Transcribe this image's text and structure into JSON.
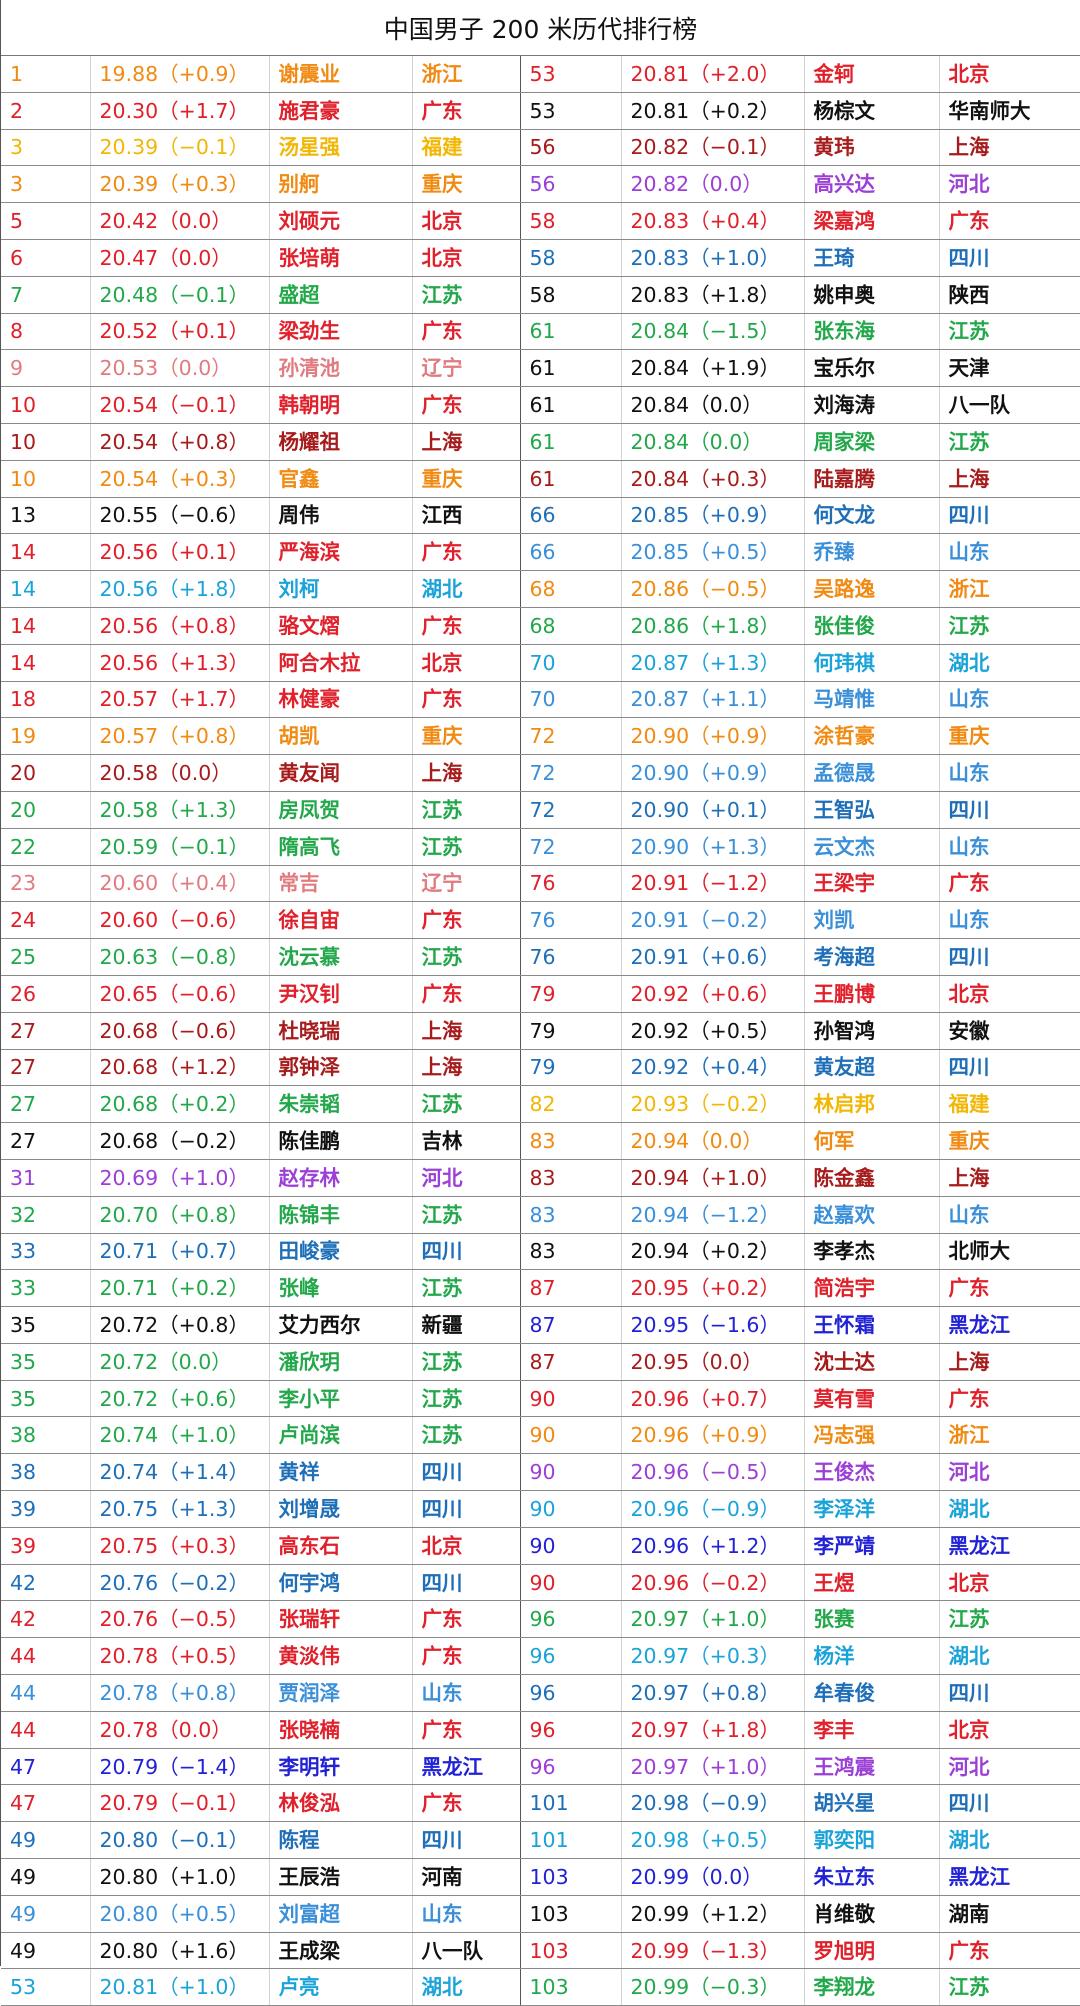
{
  "title": "中国男子 200 米历代排行榜",
  "colors": {
    "blk": "#111111",
    "red": "#e0202a",
    "dred": "#a61b1b",
    "orange": "#f08a12",
    "gold": "#f2b705",
    "green": "#22a84a",
    "pink": "#e07b80",
    "sky": "#1aa3d9",
    "blue": "#1f6fb8",
    "lblue": "#3a8fd8",
    "purple": "#9b3fd6",
    "navy": "#2121d6"
  },
  "rows": [
    {
      "left": {
        "rank": "1",
        "time": "19.88（+0.9）",
        "name": "谢震业",
        "prov": "浙江",
        "color": "orange"
      },
      "right": {
        "rank": "53",
        "time": "20.81（+2.0）",
        "name": "金轲",
        "prov": "北京",
        "color": "red"
      }
    },
    {
      "left": {
        "rank": "2",
        "time": "20.30（+1.7）",
        "name": "施君豪",
        "prov": "广东",
        "color": "red"
      },
      "right": {
        "rank": "53",
        "time": "20.81（+0.2）",
        "name": "杨棕文",
        "prov": "华南师大",
        "color": "blk"
      }
    },
    {
      "left": {
        "rank": "3",
        "time": "20.39（−0.1）",
        "name": "汤星强",
        "prov": "福建",
        "color": "gold"
      },
      "right": {
        "rank": "56",
        "time": "20.82（−0.1）",
        "name": "黄玮",
        "prov": "上海",
        "color": "dred"
      }
    },
    {
      "left": {
        "rank": "3",
        "time": "20.39（+0.3）",
        "name": "别舸",
        "prov": "重庆",
        "color": "orange"
      },
      "right": {
        "rank": "56",
        "time": "20.82（0.0）",
        "name": "高兴达",
        "prov": "河北",
        "color": "purple"
      }
    },
    {
      "left": {
        "rank": "5",
        "time": "20.42（0.0）",
        "name": "刘硕元",
        "prov": "北京",
        "color": "red"
      },
      "right": {
        "rank": "58",
        "time": "20.83（+0.4）",
        "name": "梁嘉鸿",
        "prov": "广东",
        "color": "red"
      }
    },
    {
      "left": {
        "rank": "6",
        "time": "20.47（0.0）",
        "name": "张培萌",
        "prov": "北京",
        "color": "red"
      },
      "right": {
        "rank": "58",
        "time": "20.83（+1.0）",
        "name": "王琦",
        "prov": "四川",
        "color": "blue"
      }
    },
    {
      "left": {
        "rank": "7",
        "time": "20.48（−0.1）",
        "name": "盛超",
        "prov": "江苏",
        "color": "green"
      },
      "right": {
        "rank": "58",
        "time": "20.83（+1.8）",
        "name": "姚申奥",
        "prov": "陕西",
        "color": "blk"
      }
    },
    {
      "left": {
        "rank": "8",
        "time": "20.52（+0.1）",
        "name": "梁劲生",
        "prov": "广东",
        "color": "red"
      },
      "right": {
        "rank": "61",
        "time": "20.84（−1.5）",
        "name": "张东海",
        "prov": "江苏",
        "color": "green"
      }
    },
    {
      "left": {
        "rank": "9",
        "time": "20.53（0.0）",
        "name": "孙清池",
        "prov": "辽宁",
        "color": "pink"
      },
      "right": {
        "rank": "61",
        "time": "20.84（+1.9）",
        "name": "宝乐尔",
        "prov": "天津",
        "color": "blk"
      }
    },
    {
      "left": {
        "rank": "10",
        "time": "20.54（−0.1）",
        "name": "韩朝明",
        "prov": "广东",
        "color": "red"
      },
      "right": {
        "rank": "61",
        "time": "20.84（0.0）",
        "name": "刘海涛",
        "prov": "八一队",
        "color": "blk"
      }
    },
    {
      "left": {
        "rank": "10",
        "time": "20.54（+0.8）",
        "name": "杨耀祖",
        "prov": "上海",
        "color": "dred"
      },
      "right": {
        "rank": "61",
        "time": "20.84（0.0）",
        "name": "周家梁",
        "prov": "江苏",
        "color": "green"
      }
    },
    {
      "left": {
        "rank": "10",
        "time": "20.54（+0.3）",
        "name": "官鑫",
        "prov": "重庆",
        "color": "orange"
      },
      "right": {
        "rank": "61",
        "time": "20.84（+0.3）",
        "name": "陆嘉腾",
        "prov": "上海",
        "color": "dred"
      }
    },
    {
      "left": {
        "rank": "13",
        "time": "20.55（−0.6）",
        "name": "周伟",
        "prov": "江西",
        "color": "blk"
      },
      "right": {
        "rank": "66",
        "time": "20.85（+0.9）",
        "name": "何文龙",
        "prov": "四川",
        "color": "blue"
      }
    },
    {
      "left": {
        "rank": "14",
        "time": "20.56（+0.1）",
        "name": "严海滨",
        "prov": "广东",
        "color": "red"
      },
      "right": {
        "rank": "66",
        "time": "20.85（+0.5）",
        "name": "乔臻",
        "prov": "山东",
        "color": "lblue"
      }
    },
    {
      "left": {
        "rank": "14",
        "time": "20.56（+1.8）",
        "name": "刘柯",
        "prov": "湖北",
        "color": "sky"
      },
      "right": {
        "rank": "68",
        "time": "20.86（−0.5）",
        "name": "吴路逸",
        "prov": "浙江",
        "color": "orange"
      }
    },
    {
      "left": {
        "rank": "14",
        "time": "20.56（+0.8）",
        "name": "骆文熠",
        "prov": "广东",
        "color": "red"
      },
      "right": {
        "rank": "68",
        "time": "20.86（+1.8）",
        "name": "张佳俊",
        "prov": "江苏",
        "color": "green"
      }
    },
    {
      "left": {
        "rank": "14",
        "time": "20.56（+1.3）",
        "name": "阿合木拉",
        "prov": "北京",
        "color": "red"
      },
      "right": {
        "rank": "70",
        "time": "20.87（+1.3）",
        "name": "何玮祺",
        "prov": "湖北",
        "color": "sky"
      }
    },
    {
      "left": {
        "rank": "18",
        "time": "20.57（+1.7）",
        "name": "林健豪",
        "prov": "广东",
        "color": "red"
      },
      "right": {
        "rank": "70",
        "time": "20.87（+1.1）",
        "name": "马靖惟",
        "prov": "山东",
        "color": "lblue"
      }
    },
    {
      "left": {
        "rank": "19",
        "time": "20.57（+0.8）",
        "name": "胡凯",
        "prov": "重庆",
        "color": "orange"
      },
      "right": {
        "rank": "72",
        "time": "20.90（+0.9）",
        "name": "涂哲豪",
        "prov": "重庆",
        "color": "orange"
      }
    },
    {
      "left": {
        "rank": "20",
        "time": "20.58（0.0）",
        "name": "黄友闻",
        "prov": "上海",
        "color": "dred"
      },
      "right": {
        "rank": "72",
        "time": "20.90（+0.9）",
        "name": "孟德晟",
        "prov": "山东",
        "color": "lblue"
      }
    },
    {
      "left": {
        "rank": "20",
        "time": "20.58（+1.3）",
        "name": "房凤贺",
        "prov": "江苏",
        "color": "green"
      },
      "right": {
        "rank": "72",
        "time": "20.90（+0.1）",
        "name": "王智弘",
        "prov": "四川",
        "color": "blue"
      }
    },
    {
      "left": {
        "rank": "22",
        "time": "20.59（−0.1）",
        "name": "隋高飞",
        "prov": "江苏",
        "color": "green"
      },
      "right": {
        "rank": "72",
        "time": "20.90（+1.3）",
        "name": "云文杰",
        "prov": "山东",
        "color": "lblue"
      }
    },
    {
      "left": {
        "rank": "23",
        "time": "20.60（+0.4）",
        "name": "常吉",
        "prov": "辽宁",
        "color": "pink"
      },
      "right": {
        "rank": "76",
        "time": "20.91（−1.2）",
        "name": "王梁宇",
        "prov": "广东",
        "color": "red"
      }
    },
    {
      "left": {
        "rank": "24",
        "time": "20.60（−0.6）",
        "name": "徐自宙",
        "prov": "广东",
        "color": "red"
      },
      "right": {
        "rank": "76",
        "time": "20.91（−0.2）",
        "name": "刘凯",
        "prov": "山东",
        "color": "lblue"
      }
    },
    {
      "left": {
        "rank": "25",
        "time": "20.63（−0.8）",
        "name": "沈云慕",
        "prov": "江苏",
        "color": "green"
      },
      "right": {
        "rank": "76",
        "time": "20.91（+0.6）",
        "name": "考海超",
        "prov": "四川",
        "color": "blue"
      }
    },
    {
      "left": {
        "rank": "26",
        "time": "20.65（−0.6）",
        "name": "尹汉钊",
        "prov": "广东",
        "color": "red"
      },
      "right": {
        "rank": "79",
        "time": "20.92（+0.6）",
        "name": "王鹏博",
        "prov": "北京",
        "color": "red"
      }
    },
    {
      "left": {
        "rank": "27",
        "time": "20.68（−0.6）",
        "name": "杜晓瑞",
        "prov": "上海",
        "color": "dred"
      },
      "right": {
        "rank": "79",
        "time": "20.92（+0.5）",
        "name": "孙智鸿",
        "prov": "安徽",
        "color": "blk"
      }
    },
    {
      "left": {
        "rank": "27",
        "time": "20.68（+1.2）",
        "name": "郭钟泽",
        "prov": "上海",
        "color": "dred"
      },
      "right": {
        "rank": "79",
        "time": "20.92（+0.4）",
        "name": "黄友超",
        "prov": "四川",
        "color": "blue"
      }
    },
    {
      "left": {
        "rank": "27",
        "time": "20.68（+0.2）",
        "name": "朱崇韬",
        "prov": "江苏",
        "color": "green"
      },
      "right": {
        "rank": "82",
        "time": "20.93（−0.2）",
        "name": "林启邦",
        "prov": "福建",
        "color": "gold"
      }
    },
    {
      "left": {
        "rank": "27",
        "time": "20.68（−0.2）",
        "name": "陈佳鹏",
        "prov": "吉林",
        "color": "blk"
      },
      "right": {
        "rank": "83",
        "time": "20.94（0.0）",
        "name": "何军",
        "prov": "重庆",
        "color": "orange"
      }
    },
    {
      "left": {
        "rank": "31",
        "time": "20.69（+1.0）",
        "name": "赵存林",
        "prov": "河北",
        "color": "purple"
      },
      "right": {
        "rank": "83",
        "time": "20.94（+1.0）",
        "name": "陈金鑫",
        "prov": "上海",
        "color": "dred"
      }
    },
    {
      "left": {
        "rank": "32",
        "time": "20.70（+0.8）",
        "name": "陈锦丰",
        "prov": "江苏",
        "color": "green"
      },
      "right": {
        "rank": "83",
        "time": "20.94（−1.2）",
        "name": "赵嘉欢",
        "prov": "山东",
        "color": "lblue"
      }
    },
    {
      "left": {
        "rank": "33",
        "time": "20.71（+0.7）",
        "name": "田峻豪",
        "prov": "四川",
        "color": "blue"
      },
      "right": {
        "rank": "83",
        "time": "20.94（+0.2）",
        "name": "李孝杰",
        "prov": "北师大",
        "color": "blk"
      }
    },
    {
      "left": {
        "rank": "33",
        "time": "20.71（+0.2）",
        "name": "张峰",
        "prov": "江苏",
        "color": "green"
      },
      "right": {
        "rank": "87",
        "time": "20.95（+0.2）",
        "name": "简浩宇",
        "prov": "广东",
        "color": "red"
      }
    },
    {
      "left": {
        "rank": "35",
        "time": "20.72（+0.8）",
        "name": "艾力西尔",
        "prov": "新疆",
        "color": "blk"
      },
      "right": {
        "rank": "87",
        "time": "20.95（−1.6）",
        "name": "王怀霜",
        "prov": "黑龙江",
        "color": "navy"
      }
    },
    {
      "left": {
        "rank": "35",
        "time": "20.72（0.0）",
        "name": "潘欣玥",
        "prov": "江苏",
        "color": "green"
      },
      "right": {
        "rank": "87",
        "time": "20.95（0.0）",
        "name": "沈士达",
        "prov": "上海",
        "color": "dred"
      }
    },
    {
      "left": {
        "rank": "35",
        "time": "20.72（+0.6）",
        "name": "李小平",
        "prov": "江苏",
        "color": "green"
      },
      "right": {
        "rank": "90",
        "time": "20.96（+0.7）",
        "name": "莫有雪",
        "prov": "广东",
        "color": "red"
      }
    },
    {
      "left": {
        "rank": "38",
        "time": "20.74（+1.0）",
        "name": "卢尚滨",
        "prov": "江苏",
        "color": "green"
      },
      "right": {
        "rank": "90",
        "time": "20.96（+0.9）",
        "name": "冯志强",
        "prov": "浙江",
        "color": "orange"
      }
    },
    {
      "left": {
        "rank": "38",
        "time": "20.74（+1.4）",
        "name": "黄祥",
        "prov": "四川",
        "color": "blue"
      },
      "right": {
        "rank": "90",
        "time": "20.96（−0.5）",
        "name": "王俊杰",
        "prov": "河北",
        "color": "purple"
      }
    },
    {
      "left": {
        "rank": "39",
        "time": "20.75（+1.3）",
        "name": "刘增晟",
        "prov": "四川",
        "color": "blue"
      },
      "right": {
        "rank": "90",
        "time": "20.96（−0.9）",
        "name": "李泽洋",
        "prov": "湖北",
        "color": "sky"
      }
    },
    {
      "left": {
        "rank": "39",
        "time": "20.75（+0.3）",
        "name": "高东石",
        "prov": "北京",
        "color": "red"
      },
      "right": {
        "rank": "90",
        "time": "20.96（+1.2）",
        "name": "李严靖",
        "prov": "黑龙江",
        "color": "navy"
      }
    },
    {
      "left": {
        "rank": "42",
        "time": "20.76（−0.2）",
        "name": "何宇鸿",
        "prov": "四川",
        "color": "blue"
      },
      "right": {
        "rank": "90",
        "time": "20.96（−0.2）",
        "name": "王煜",
        "prov": "北京",
        "color": "red"
      }
    },
    {
      "left": {
        "rank": "42",
        "time": "20.76（−0.5）",
        "name": "张瑞轩",
        "prov": "广东",
        "color": "red"
      },
      "right": {
        "rank": "96",
        "time": "20.97（+1.0）",
        "name": "张赛",
        "prov": "江苏",
        "color": "green"
      }
    },
    {
      "left": {
        "rank": "44",
        "time": "20.78（+0.5）",
        "name": "黄淡伟",
        "prov": "广东",
        "color": "red"
      },
      "right": {
        "rank": "96",
        "time": "20.97（+0.3）",
        "name": "杨洋",
        "prov": "湖北",
        "color": "sky"
      }
    },
    {
      "left": {
        "rank": "44",
        "time": "20.78（+0.8）",
        "name": "贾润泽",
        "prov": "山东",
        "color": "lblue"
      },
      "right": {
        "rank": "96",
        "time": "20.97（+0.8）",
        "name": "牟春俊",
        "prov": "四川",
        "color": "blue"
      }
    },
    {
      "left": {
        "rank": "44",
        "time": "20.78（0.0）",
        "name": "张晓楠",
        "prov": "广东",
        "color": "red"
      },
      "right": {
        "rank": "96",
        "time": "20.97（+1.8）",
        "name": "李丰",
        "prov": "北京",
        "color": "red"
      }
    },
    {
      "left": {
        "rank": "47",
        "time": "20.79（−1.4）",
        "name": "李明轩",
        "prov": "黑龙江",
        "color": "navy"
      },
      "right": {
        "rank": "96",
        "time": "20.97（+1.0）",
        "name": "王鸿震",
        "prov": "河北",
        "color": "purple"
      }
    },
    {
      "left": {
        "rank": "47",
        "time": "20.79（−0.1）",
        "name": "林俊泓",
        "prov": "广东",
        "color": "red"
      },
      "right": {
        "rank": "101",
        "time": "20.98（−0.9）",
        "name": "胡兴星",
        "prov": "四川",
        "color": "blue"
      }
    },
    {
      "left": {
        "rank": "49",
        "time": "20.80（−0.1）",
        "name": "陈程",
        "prov": "四川",
        "color": "blue"
      },
      "right": {
        "rank": "101",
        "time": "20.98（+0.5）",
        "name": "郭奕阳",
        "prov": "湖北",
        "color": "sky"
      }
    },
    {
      "left": {
        "rank": "49",
        "time": "20.80（+1.0）",
        "name": "王辰浩",
        "prov": "河南",
        "color": "blk"
      },
      "right": {
        "rank": "103",
        "time": "20.99（0.0）",
        "name": "朱立东",
        "prov": "黑龙江",
        "color": "navy"
      }
    },
    {
      "left": {
        "rank": "49",
        "time": "20.80（+0.5）",
        "name": "刘富超",
        "prov": "山东",
        "color": "lblue"
      },
      "right": {
        "rank": "103",
        "time": "20.99（+1.2）",
        "name": "肖维敬",
        "prov": "湖南",
        "color": "blk"
      }
    },
    {
      "left": {
        "rank": "49",
        "time": "20.80（+1.6）",
        "name": "王成梁",
        "prov": "八一队",
        "color": "blk"
      },
      "right": {
        "rank": "103",
        "time": "20.99（−1.3）",
        "name": "罗旭明",
        "prov": "广东",
        "color": "red"
      }
    },
    {
      "left": {
        "rank": "53",
        "time": "20.81（+1.0）",
        "name": "卢亮",
        "prov": "湖北",
        "color": "sky"
      },
      "right": {
        "rank": "103",
        "time": "20.99（−0.3）",
        "name": "李翔龙",
        "prov": "江苏",
        "color": "green"
      }
    }
  ]
}
